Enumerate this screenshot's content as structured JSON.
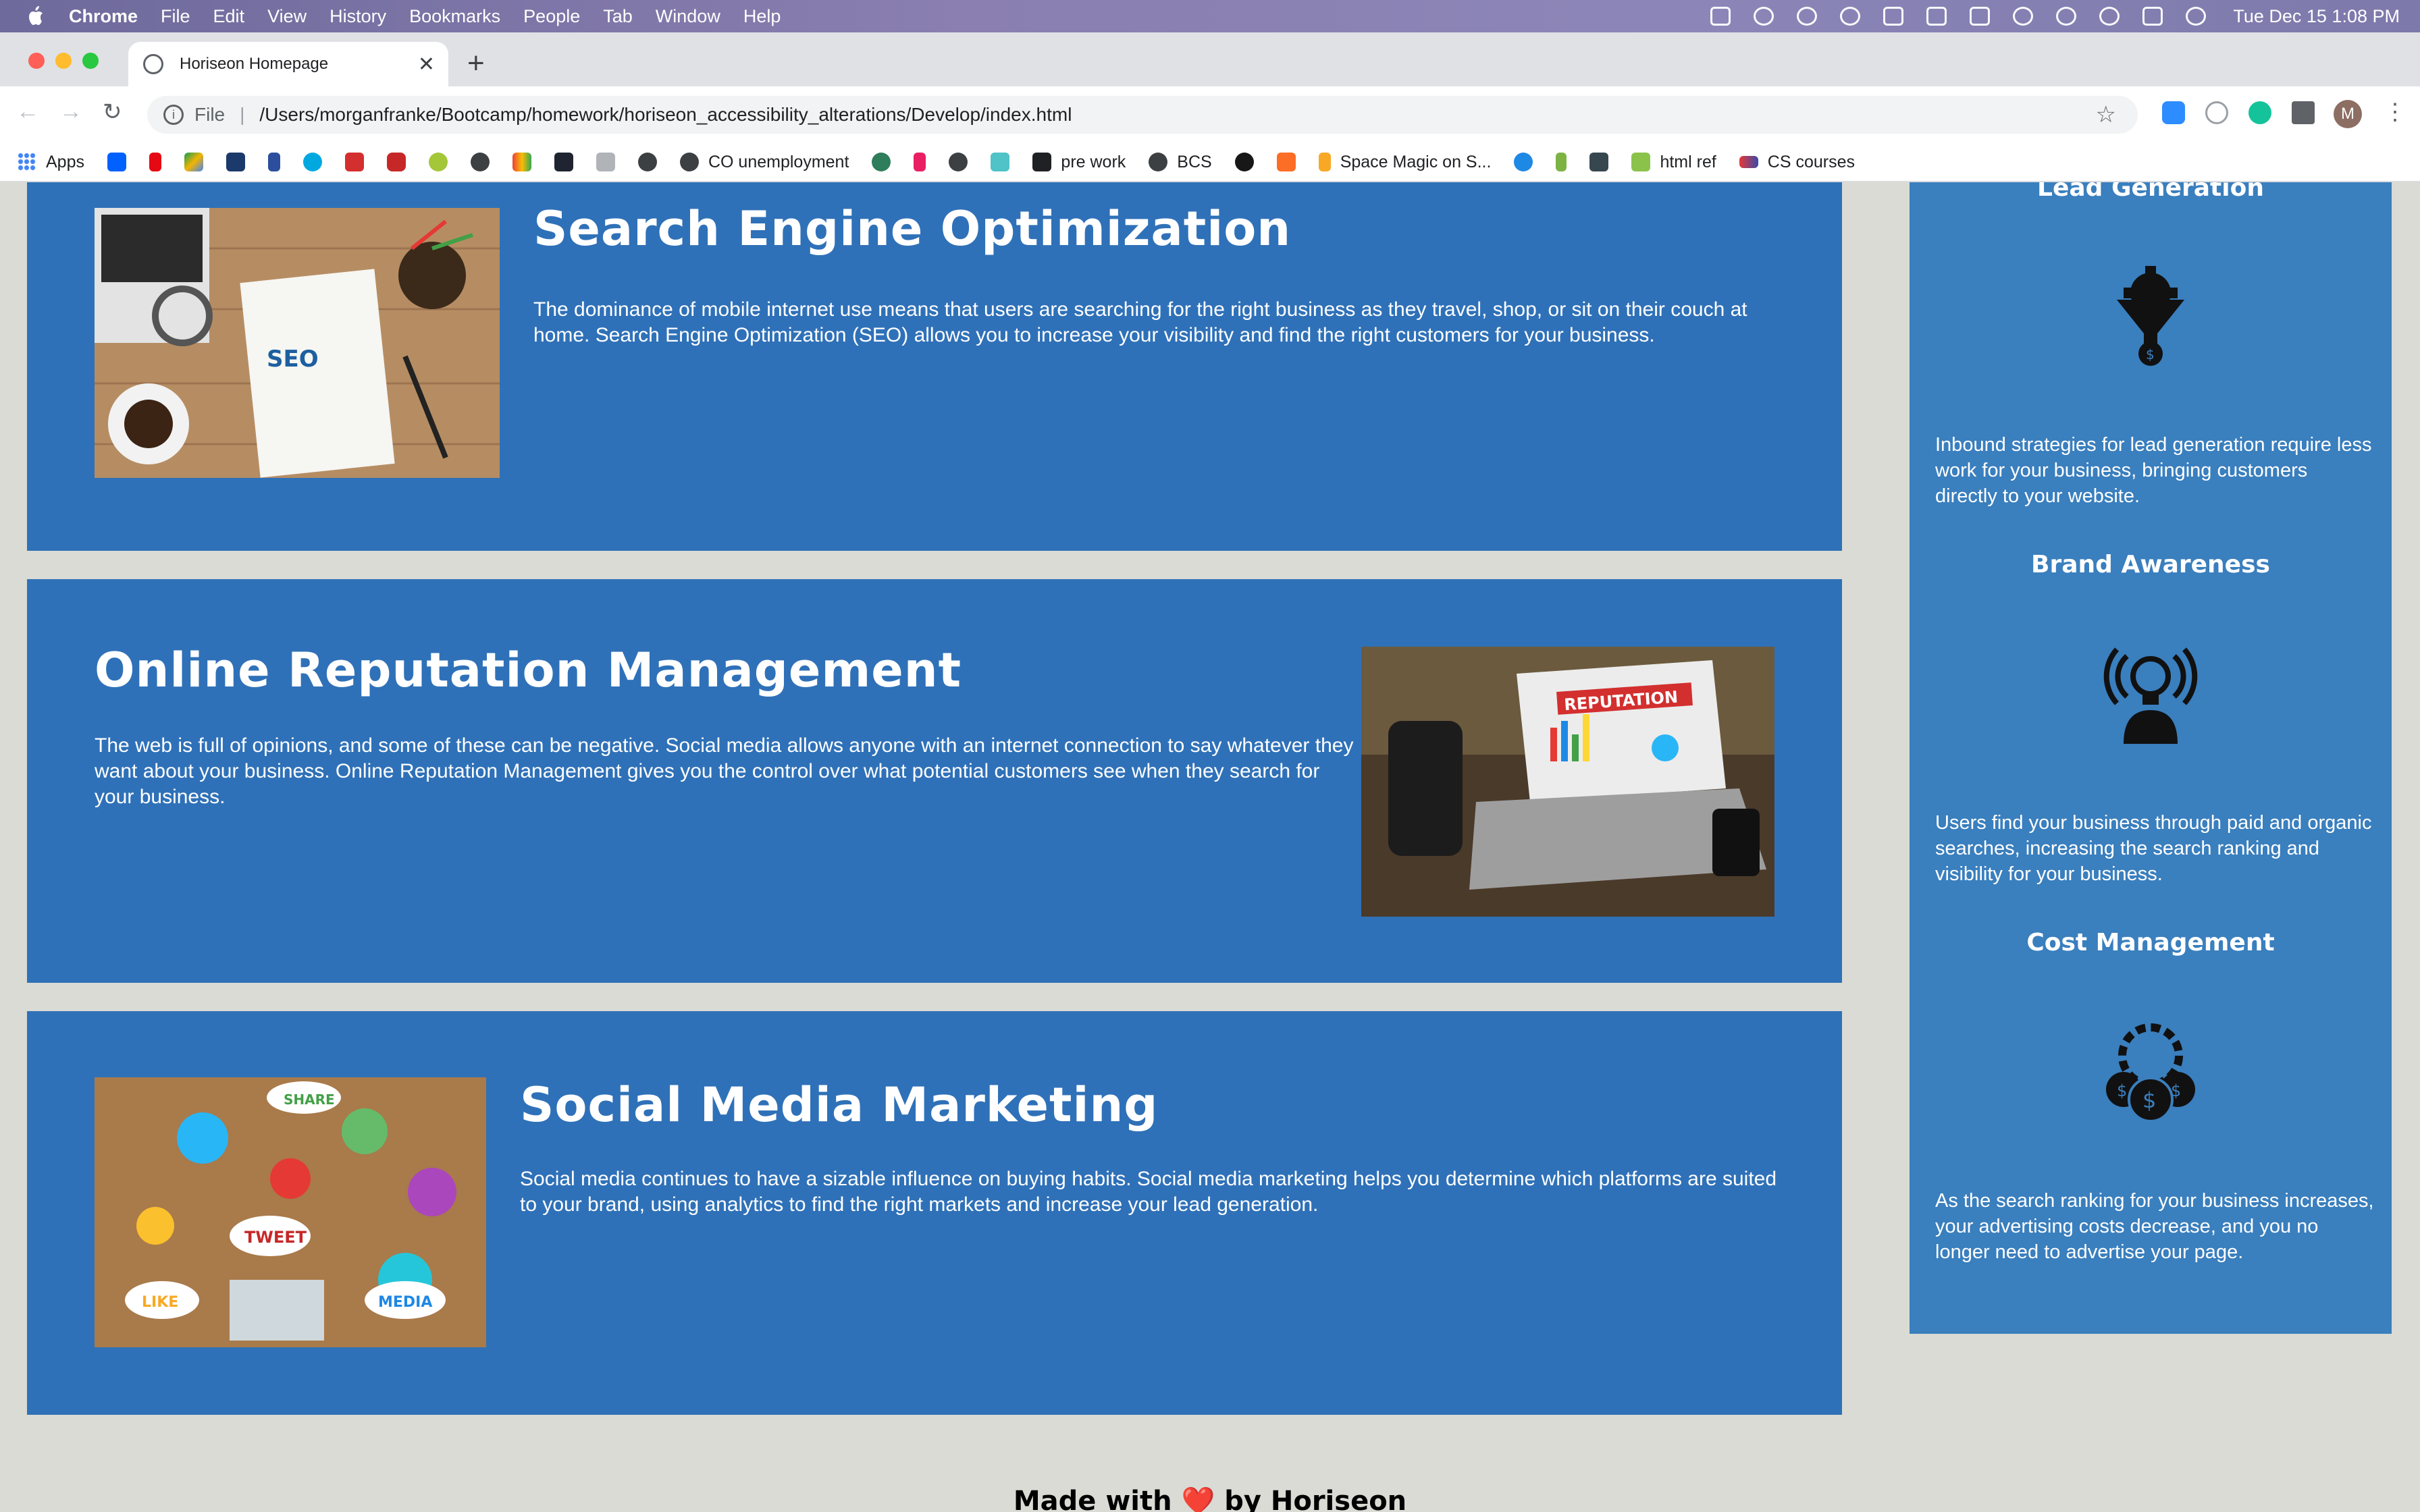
{
  "menubar": {
    "app": "Chrome",
    "items": [
      "File",
      "Edit",
      "View",
      "History",
      "Bookmarks",
      "People",
      "Tab",
      "Window",
      "Help"
    ],
    "clock": "Tue Dec 15  1:08 PM"
  },
  "tab": {
    "title": "Horiseon Homepage"
  },
  "address": {
    "scheme": "File",
    "url": "/Users/morganfranke/Bootcamp/homework/horiseon_accessibility_alterations/Develop/index.html"
  },
  "bookmarks": {
    "apps": "Apps",
    "co_unemployment": "CO unemployment",
    "pre_work": "pre work",
    "bcs": "BCS",
    "space_magic": "Space Magic on S...",
    "html_ref": "html ref",
    "cs_courses": "CS courses"
  },
  "content": {
    "seo": {
      "title": "Search Engine Optimization",
      "body": "The dominance of mobile internet use means that users are searching for the right business as they travel, shop, or sit on their couch at home. Search Engine Optimization (SEO) allows you to increase your visibility and find the right customers for your business."
    },
    "orm": {
      "title": "Online Reputation Management",
      "body": "The web is full of opinions, and some of these can be negative. Social media allows anyone with an internet connection to say whatever they want about your business. Online Reputation Management gives you the control over what potential customers see when they search for your business."
    },
    "smm": {
      "title": "Social Media Marketing",
      "body": "Social media continues to have a sizable influence on buying habits. Social media marketing helps you determine which platforms are suited to your brand, using analytics to find the right markets and increase your lead generation."
    }
  },
  "sidebar": {
    "lead": {
      "title": "Lead Generation",
      "body": "Inbound strategies for lead generation require less work for your business, bringing customers directly to your website."
    },
    "brand": {
      "title": "Brand Awareness",
      "body": "Users find your business through paid and organic searches, increasing the search ranking and visibility for your business."
    },
    "cost": {
      "title": "Cost Management",
      "body": "As the search ranking for your business increases, your advertising costs decrease, and you no longer need to advertise your page."
    }
  },
  "footer": {
    "text": "Made with ❤️ by Horiseon"
  }
}
